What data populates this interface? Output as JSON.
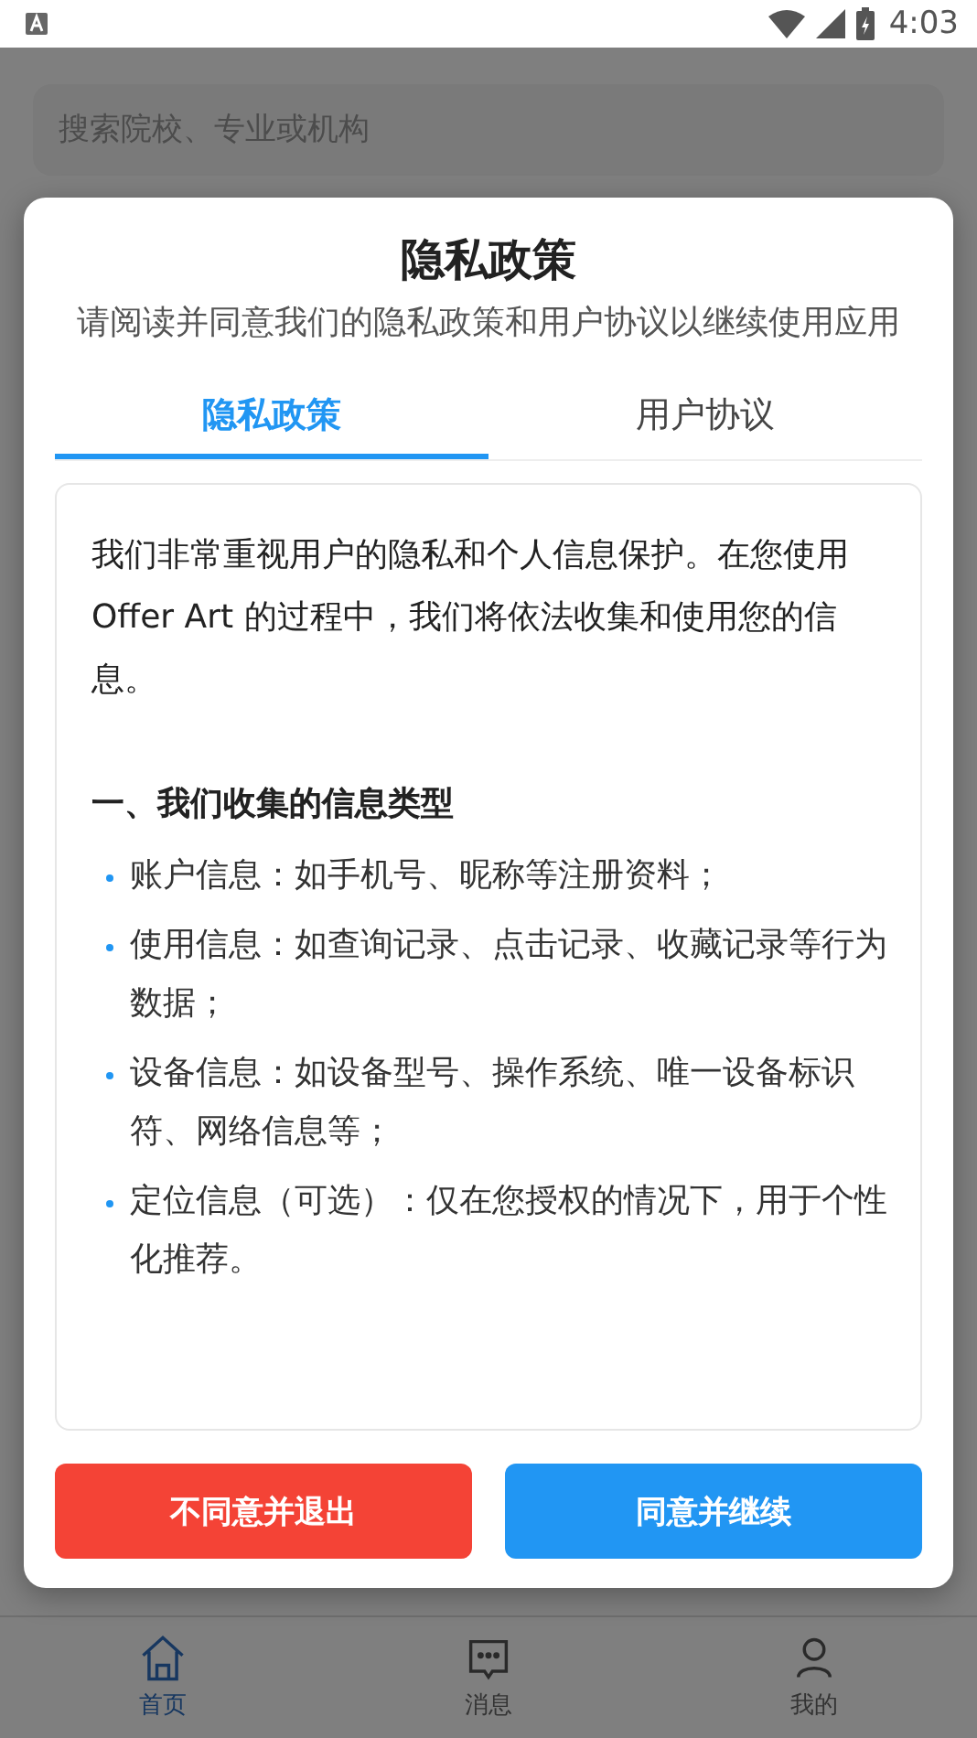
{
  "status_bar": {
    "time": "4:03"
  },
  "search": {
    "placeholder": "搜索院校、专业或机构"
  },
  "dialog": {
    "title": "隐私政策",
    "subtitle": "请阅读并同意我们的隐私政策和用户协议以继续使用应用",
    "tabs": [
      {
        "label": "隐私政策",
        "selected": true
      },
      {
        "label": "用户协议",
        "selected": false
      }
    ],
    "intro": "我们非常重视用户的隐私和个人信息保护。在您使用 Offer Art 的过程中，我们将依法收集和使用您的信息。",
    "section_heading": "一、我们收集的信息类型",
    "bullets": [
      "账户信息：如手机号、昵称等注册资料；",
      "使用信息：如查询记录、点击记录、收藏记录等行为数据；",
      "设备信息：如设备型号、操作系统、唯一设备标识符、网络信息等；",
      "定位信息（可选）：仅在您授权的情况下，用于个性化推荐。"
    ],
    "buttons": [
      {
        "kind": "decline",
        "label": "不同意并退出"
      },
      {
        "kind": "accept",
        "label": "同意并继续"
      }
    ]
  },
  "bottom_nav": [
    {
      "kind": "home",
      "label": "首页",
      "selected": true
    },
    {
      "kind": "messages",
      "label": "消息",
      "selected": false
    },
    {
      "kind": "profile",
      "label": "我的",
      "selected": false
    }
  ]
}
